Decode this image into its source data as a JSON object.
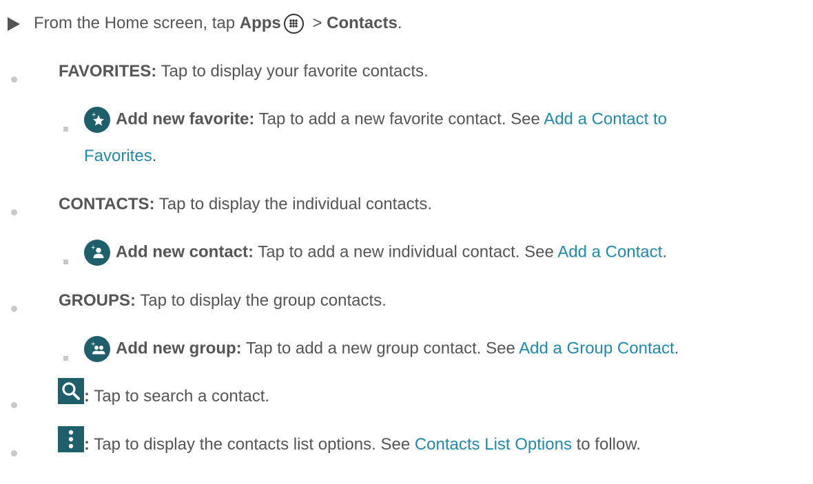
{
  "intro": {
    "text_before": "From the Home screen, tap ",
    "apps_label": "Apps",
    "separator": " > ",
    "contacts_label": "Contacts",
    "period": "."
  },
  "items": {
    "favorites": {
      "label": "FAVORITES:",
      "text": " Tap to display your favorite contacts.",
      "sub": {
        "icon": "add-favorite-icon",
        "label": "Add new favorite:",
        "text": " Tap to add a new favorite contact. See ",
        "link_part1": "Add a Contact to",
        "link_part2": "Favorites",
        "end": "."
      }
    },
    "contacts": {
      "label": "CONTACTS:",
      "text": " Tap to display the individual contacts.",
      "sub": {
        "icon": "add-contact-icon",
        "label": "Add new contact:",
        "text": " Tap to add a new individual contact. See ",
        "link": "Add a Contact",
        "end": "."
      }
    },
    "groups": {
      "label": "GROUPS:",
      "text": " Tap to display the group contacts.",
      "sub": {
        "icon": "add-group-icon",
        "label": "Add new group:",
        "text": " Tap to add a new group contact. See ",
        "link": "Add a Group Contact",
        "end": "."
      }
    },
    "search": {
      "icon": "search-icon",
      "label": ":",
      "text": " Tap to search a contact."
    },
    "more": {
      "icon": "more-options-icon",
      "label": ":",
      "text": " Tap to display the contacts list options. See ",
      "link": "Contacts List Options",
      "end": " to follow."
    }
  },
  "colors": {
    "text": "#555555",
    "link": "#1f8ab0",
    "icon_bg": "#1e5f6b",
    "bullet": "#c8c8c8"
  }
}
